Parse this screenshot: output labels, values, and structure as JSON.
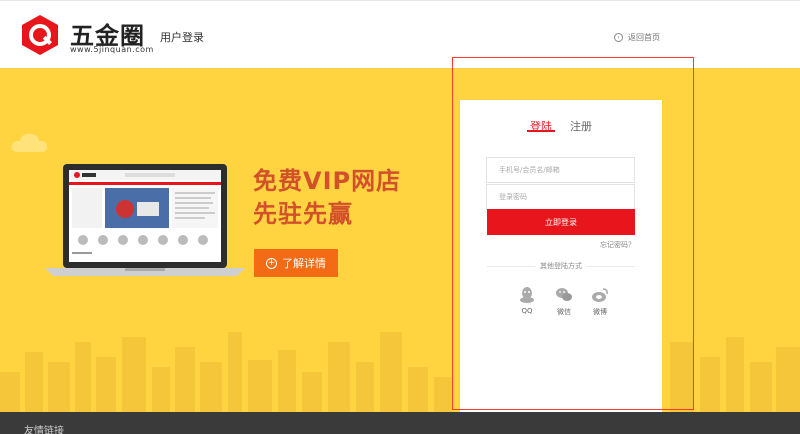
{
  "header": {
    "brand_name": "五金圈",
    "brand_url": "www.5jinquan.com",
    "page_label": "用户登录",
    "back_home": "返回首页"
  },
  "banner": {
    "promo_line1": "免费VIP网店",
    "promo_line2": "先驻先赢",
    "detail_button": "了解详情",
    "laptop_site_name": "五金圈"
  },
  "login": {
    "tab_login": "登陆",
    "tab_register": "注册",
    "username_placeholder": "手机号/会员名/邮箱",
    "password_placeholder": "登录密码",
    "submit_label": "立即登录",
    "forgot_label": "忘记密码？",
    "other_methods": "其他登陆方式",
    "social": [
      {
        "label": "QQ",
        "icon": "qq-icon"
      },
      {
        "label": "微信",
        "icon": "wechat-icon"
      },
      {
        "label": "微博",
        "icon": "weibo-icon"
      }
    ]
  },
  "footer": {
    "links_title": "友情链接"
  },
  "colors": {
    "brand_red": "#e8161c",
    "banner_yellow": "#ffd440",
    "promo_text": "#d2512a",
    "button_orange": "#f46b15"
  }
}
